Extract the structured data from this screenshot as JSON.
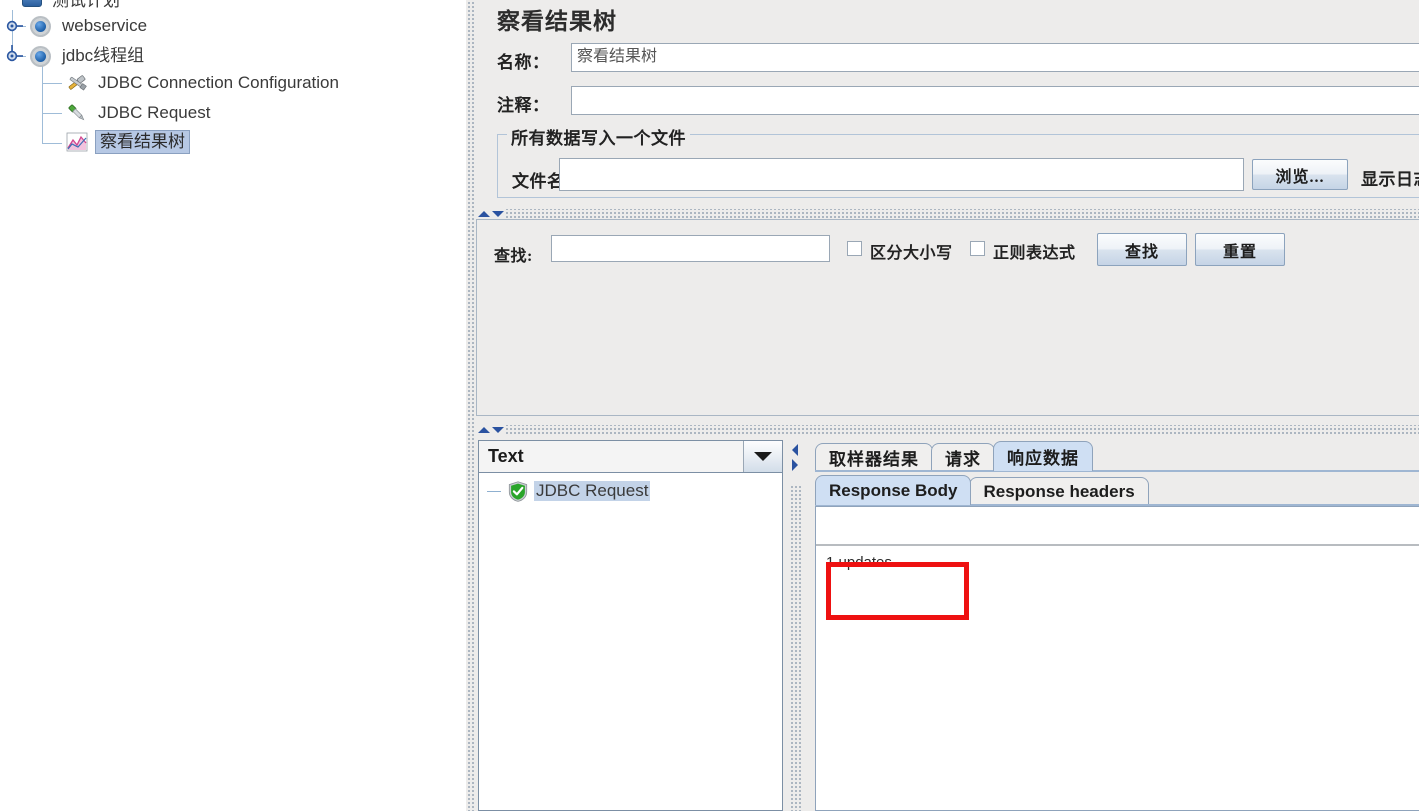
{
  "tree": {
    "nodes": [
      {
        "label": "测试计划",
        "icon": "test-plan-icon",
        "depth": 0,
        "selected": false,
        "clipped": true
      },
      {
        "label": "webservice",
        "icon": "thread-group-icon",
        "depth": 1,
        "selected": false
      },
      {
        "label": "jdbc线程组",
        "icon": "thread-group-icon",
        "depth": 1,
        "selected": false
      },
      {
        "label": "JDBC Connection Configuration",
        "icon": "config-element-icon",
        "depth": 2,
        "selected": false
      },
      {
        "label": "JDBC Request",
        "icon": "sampler-icon",
        "depth": 2,
        "selected": false
      },
      {
        "label": "察看结果树",
        "icon": "listener-chart-icon",
        "depth": 2,
        "selected": true
      }
    ]
  },
  "panel": {
    "title": "察看结果树",
    "name_label": "名称：",
    "name_value": "察看结果树",
    "comment_label": "注释：",
    "comment_value": "",
    "filegroup": {
      "title": "所有数据写入一个文件",
      "filename_label": "文件名",
      "filename_value": "",
      "browse_button": "浏览...",
      "log_display_label": "显示日志"
    }
  },
  "search": {
    "label": "查找:",
    "value": "",
    "case_sensitive_label": "区分大小写",
    "case_sensitive_checked": false,
    "regex_label": "正则表达式",
    "regex_checked": false,
    "find_button": "查找",
    "reset_button": "重置"
  },
  "results": {
    "render_combo_value": "Text",
    "tree_items": [
      {
        "label": "JDBC Request",
        "status": "success",
        "selected": true
      }
    ]
  },
  "tabs": {
    "primary": [
      {
        "label": "取样器结果",
        "active": false
      },
      {
        "label": "请求",
        "active": false
      },
      {
        "label": "响应数据",
        "active": true
      }
    ],
    "secondary": [
      {
        "label": "Response Body",
        "active": true
      },
      {
        "label": "Response headers",
        "active": false
      }
    ]
  },
  "response": {
    "filter_value": "",
    "body": "1 updates"
  },
  "annotation": {
    "highlight_color": "#ee1111",
    "highlight_target": "1 updates"
  }
}
